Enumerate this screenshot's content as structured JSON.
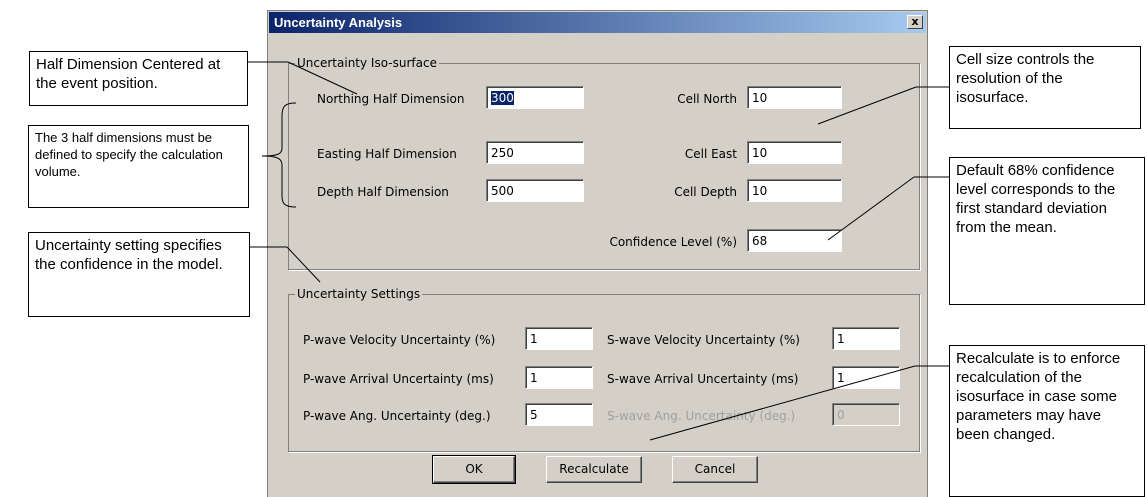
{
  "dialog": {
    "title": "Uncertainty Analysis",
    "close_label": "x",
    "iso_group": {
      "legend": "Uncertainty Iso-surface",
      "northing_label": "Northing Half Dimension",
      "northing_value": "300",
      "easting_label": "Easting Half Dimension",
      "easting_value": "250",
      "depth_label": "Depth Half Dimension",
      "depth_value": "500",
      "cell_north_label": "Cell North",
      "cell_north_value": "10",
      "cell_east_label": "Cell East",
      "cell_east_value": "10",
      "cell_depth_label": "Cell Depth",
      "cell_depth_value": "10",
      "confidence_label": "Confidence Level (%)",
      "confidence_value": "68"
    },
    "settings_group": {
      "legend": "Uncertainty Settings",
      "p_vel_label": "P-wave Velocity Uncertainty (%)",
      "p_vel_value": "1",
      "p_arr_label": "P-wave Arrival Uncertainty (ms)",
      "p_arr_value": "1",
      "p_ang_label": "P-wave Ang. Uncertainty (deg.)",
      "p_ang_value": "5",
      "s_vel_label": "S-wave Velocity Uncertainty (%)",
      "s_vel_value": "1",
      "s_arr_label": "S-wave Arrival Uncertainty (ms)",
      "s_arr_value": "1",
      "s_ang_label": "S-wave Ang. Uncertainty (deg.)",
      "s_ang_value": "0"
    },
    "buttons": {
      "ok": "OK",
      "recalculate": "Recalculate",
      "cancel": "Cancel"
    }
  },
  "callouts": {
    "half_dimension": "Half Dimension Centered at the event position.",
    "three_half_dims": "The 3 half dimensions must be defined to specify the calculation volume.",
    "uncertainty_setting": "Uncertainty setting specifies the confidence in the model.",
    "cell_size": "Cell size controls the resolution of the isosurface.",
    "default_confidence": "Default 68% confidence level corresponds to the first standard deviation from the mean.",
    "recalculate_note": "Recalculate is to enforce recalculation of the isosurface in case some parameters may have been changed."
  },
  "colors": {
    "title_start": "#0a246a",
    "title_end": "#a6caf0",
    "dialog_bg": "#d4d0c8",
    "selection": "#0a246a"
  }
}
